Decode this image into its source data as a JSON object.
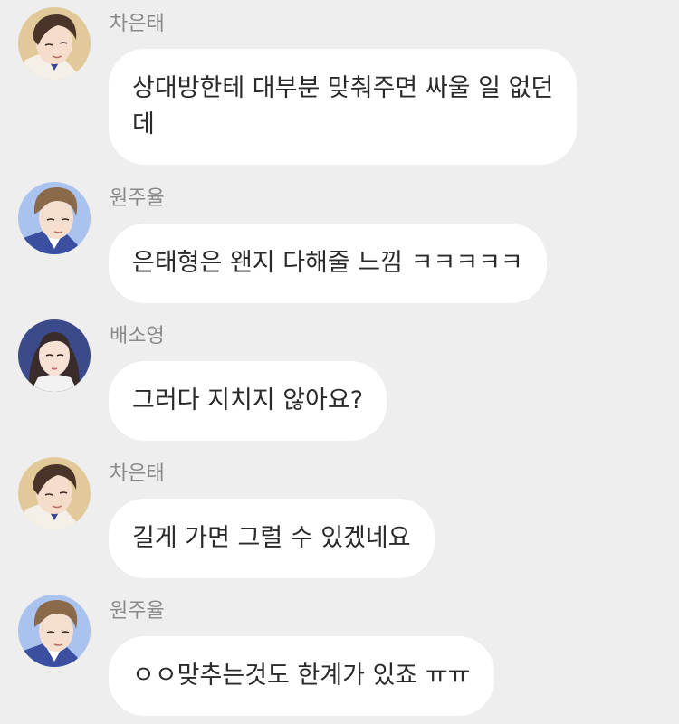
{
  "background_color": "#eeeeee",
  "bubble_color": "#ffffff",
  "name_color": "#8a8a8a",
  "text_color": "#2a2a2a",
  "messages": [
    {
      "sender": "차은태",
      "avatar": "cha-eun-tae-avatar-icon",
      "text": "상대방한테 대부분 맞춰주면 싸울 일 없던\n데"
    },
    {
      "sender": "원주율",
      "avatar": "won-ju-yul-avatar-icon",
      "text": "은태형은 왠지 다해줄 느낌 ㅋㅋㅋㅋㅋ"
    },
    {
      "sender": "배소영",
      "avatar": "bae-so-young-avatar-icon",
      "text": "그러다 지치지 않아요?"
    },
    {
      "sender": "차은태",
      "avatar": "cha-eun-tae-avatar-icon",
      "text": "길게 가면 그럴 수 있겠네요"
    },
    {
      "sender": "원주율",
      "avatar": "won-ju-yul-avatar-icon",
      "text": "ㅇㅇ맞추는것도 한계가 있죠 ㅠㅠ"
    }
  ]
}
